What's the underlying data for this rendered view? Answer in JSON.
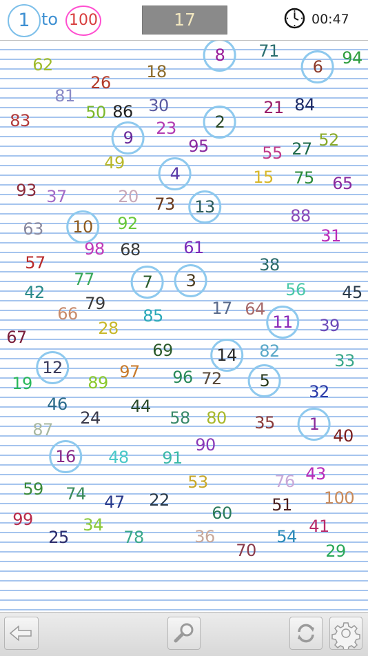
{
  "header": {
    "title_one": "1",
    "title_to": "to",
    "title_hundred": "100",
    "counter": "17",
    "timer": "00:47"
  },
  "icons": [
    "clock-icon",
    "back-arrow-icon",
    "magnifier-icon",
    "refresh-icon",
    "gear-icon"
  ],
  "numbers": [
    {
      "v": "62",
      "c": "#9fbb2a"
    },
    {
      "v": "26",
      "c": "#b33b2b"
    },
    {
      "v": "18",
      "c": "#8d6b2a"
    },
    {
      "v": "8",
      "c": "#9a1e9a",
      "found": true
    },
    {
      "v": "71",
      "c": "#2a6e6e"
    },
    {
      "v": "6",
      "c": "#8d3b2b",
      "found": true
    },
    {
      "v": "94",
      "c": "#2e9e3e"
    },
    {
      "v": "81",
      "c": "#8a8ac6"
    },
    {
      "v": "50",
      "c": "#7cb82a"
    },
    {
      "v": "86",
      "c": "#222222"
    },
    {
      "v": "30",
      "c": "#5b5ba0"
    },
    {
      "v": "21",
      "c": "#9a1e6a"
    },
    {
      "v": "84",
      "c": "#1c2a66"
    },
    {
      "v": "83",
      "c": "#b23a3a"
    },
    {
      "v": "9",
      "c": "#6a2a9a",
      "found": true
    },
    {
      "v": "23",
      "c": "#b23ab2"
    },
    {
      "v": "2",
      "c": "#2a4a2a",
      "found": true
    },
    {
      "v": "95",
      "c": "#8a2aa0"
    },
    {
      "v": "55",
      "c": "#c03a8a"
    },
    {
      "v": "27",
      "c": "#1e6a4a"
    },
    {
      "v": "52",
      "c": "#8aaa2a"
    },
    {
      "v": "49",
      "c": "#b8b82a"
    },
    {
      "v": "4",
      "c": "#5a3aa8",
      "found": true
    },
    {
      "v": "15",
      "c": "#d8b82a"
    },
    {
      "v": "75",
      "c": "#2a8a3a"
    },
    {
      "v": "65",
      "c": "#8a2aa0"
    },
    {
      "v": "93",
      "c": "#8d2b3b"
    },
    {
      "v": "37",
      "c": "#a36ac6"
    },
    {
      "v": "20",
      "c": "#c8a8b8"
    },
    {
      "v": "73",
      "c": "#6a3a1e"
    },
    {
      "v": "13",
      "c": "#2a5a5a",
      "found": true
    },
    {
      "v": "88",
      "c": "#8a4ab8"
    },
    {
      "v": "63",
      "c": "#8a8aa0"
    },
    {
      "v": "10",
      "c": "#8d5a1e",
      "found": true
    },
    {
      "v": "92",
      "c": "#6ac83a"
    },
    {
      "v": "31",
      "c": "#b82ab8"
    },
    {
      "v": "98",
      "c": "#c03ab8"
    },
    {
      "v": "68",
      "c": "#3a3a3a"
    },
    {
      "v": "61",
      "c": "#7a2ab8"
    },
    {
      "v": "57",
      "c": "#b82a2a"
    },
    {
      "v": "38",
      "c": "#2a6a6a"
    },
    {
      "v": "42",
      "c": "#2a8a8a"
    },
    {
      "v": "77",
      "c": "#3aa85a"
    },
    {
      "v": "7",
      "c": "#2a5a2a",
      "found": true
    },
    {
      "v": "3",
      "c": "#4a3a1e",
      "found": true
    },
    {
      "v": "56",
      "c": "#4ac8a8"
    },
    {
      "v": "45",
      "c": "#2a3a4a"
    },
    {
      "v": "66",
      "c": "#c88a6a"
    },
    {
      "v": "79",
      "c": "#3a3a3a"
    },
    {
      "v": "85",
      "c": "#2aa8b8"
    },
    {
      "v": "17",
      "c": "#5a6a8a"
    },
    {
      "v": "64",
      "c": "#a86a6a"
    },
    {
      "v": "11",
      "c": "#8a2ab8",
      "found": true
    },
    {
      "v": "39",
      "c": "#6a4ab8"
    },
    {
      "v": "28",
      "c": "#c8b82a"
    },
    {
      "v": "67",
      "c": "#7a1e3a"
    },
    {
      "v": "69",
      "c": "#2a5a2a"
    },
    {
      "v": "14",
      "c": "#2a2a2a",
      "found": true
    },
    {
      "v": "82",
      "c": "#5aa8c8"
    },
    {
      "v": "33",
      "c": "#3aa88a"
    },
    {
      "v": "12",
      "c": "#3a3a5a",
      "found": true
    },
    {
      "v": "97",
      "c": "#c87a2a"
    },
    {
      "v": "96",
      "c": "#2a8a5a"
    },
    {
      "v": "72",
      "c": "#5a4a3a"
    },
    {
      "v": "5",
      "c": "#2a3a1e",
      "found": true
    },
    {
      "v": "19",
      "c": "#2ab85a"
    },
    {
      "v": "89",
      "c": "#8ac82a"
    },
    {
      "v": "32",
      "c": "#2a3aa8"
    },
    {
      "v": "46",
      "c": "#2a6a8a"
    },
    {
      "v": "24",
      "c": "#3a3a4a"
    },
    {
      "v": "44",
      "c": "#2a4a2a"
    },
    {
      "v": "58",
      "c": "#3a8a6a"
    },
    {
      "v": "80",
      "c": "#a8b82a"
    },
    {
      "v": "35",
      "c": "#8a3a3a"
    },
    {
      "v": "1",
      "c": "#8a2a9a",
      "found": true
    },
    {
      "v": "40",
      "c": "#7a1e1e"
    },
    {
      "v": "87",
      "c": "#a8b8a0"
    },
    {
      "v": "16",
      "c": "#8a2a8a",
      "found": true
    },
    {
      "v": "48",
      "c": "#4ac8c8"
    },
    {
      "v": "91",
      "c": "#3ab8a8"
    },
    {
      "v": "90",
      "c": "#8a3ab8"
    },
    {
      "v": "53",
      "c": "#c8a82a"
    },
    {
      "v": "76",
      "c": "#c8a8d8"
    },
    {
      "v": "43",
      "c": "#b82ab8"
    },
    {
      "v": "59",
      "c": "#3a8a3a"
    },
    {
      "v": "74",
      "c": "#3a8a5a"
    },
    {
      "v": "47",
      "c": "#2a3a8a"
    },
    {
      "v": "22",
      "c": "#2a3a4a"
    },
    {
      "v": "51",
      "c": "#4a1e1e"
    },
    {
      "v": "100",
      "c": "#c88a5a"
    },
    {
      "v": "60",
      "c": "#2a7a5a"
    },
    {
      "v": "99",
      "c": "#b82a4a"
    },
    {
      "v": "25",
      "c": "#2a2a6a"
    },
    {
      "v": "34",
      "c": "#8ac83a"
    },
    {
      "v": "78",
      "c": "#3aa88a"
    },
    {
      "v": "36",
      "c": "#c8a89a"
    },
    {
      "v": "70",
      "c": "#8a3a4a"
    },
    {
      "v": "54",
      "c": "#2a8ab8"
    },
    {
      "v": "41",
      "c": "#b82a6a"
    },
    {
      "v": "29",
      "c": "#2aa85a"
    }
  ]
}
